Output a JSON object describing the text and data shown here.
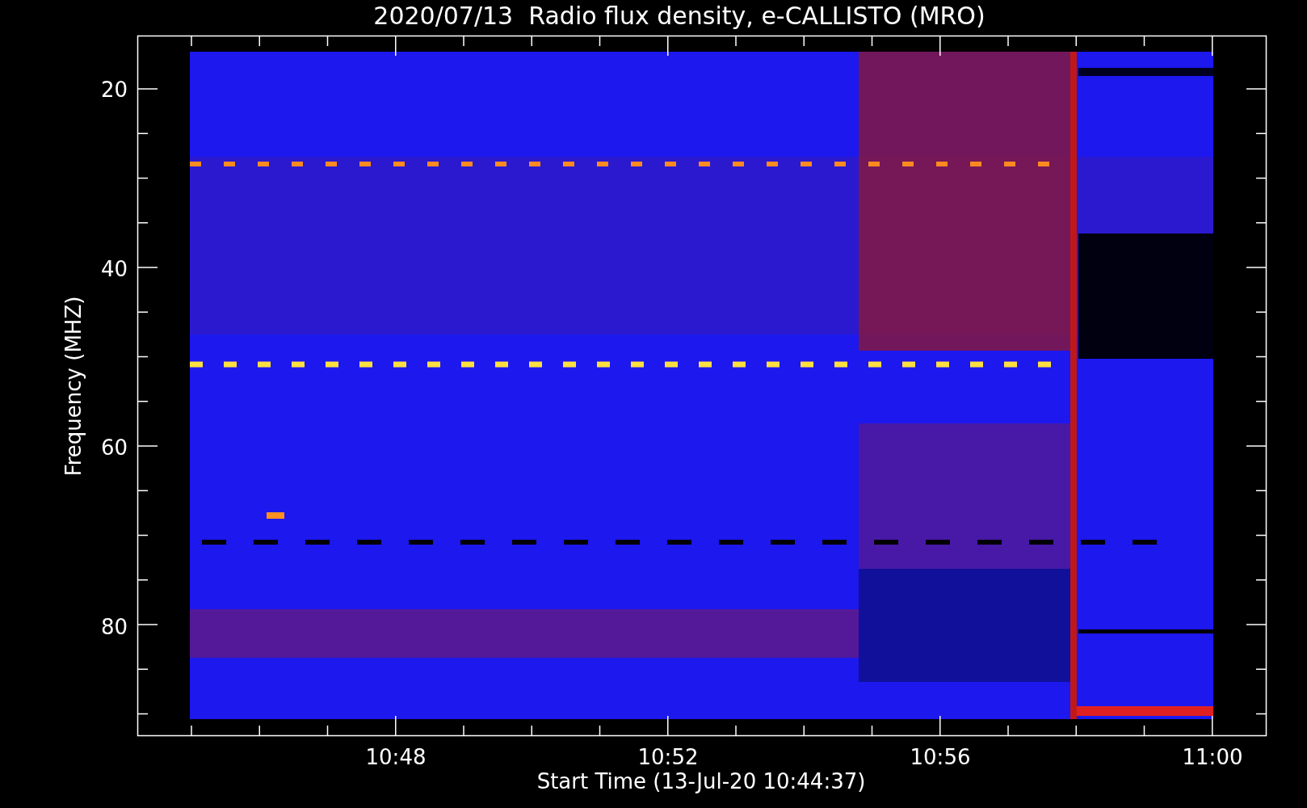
{
  "title": "2020/07/13  Radio flux density, e-CALLISTO (MRO)",
  "y_axis": {
    "label": "Frequency (MHZ)",
    "ticks": [
      "20",
      "40",
      "60",
      "80"
    ]
  },
  "x_axis": {
    "label": "Start Time (13-Jul-20 10:44:37)",
    "ticks": [
      "10:48",
      "10:52",
      "10:56",
      "11:00"
    ]
  }
}
